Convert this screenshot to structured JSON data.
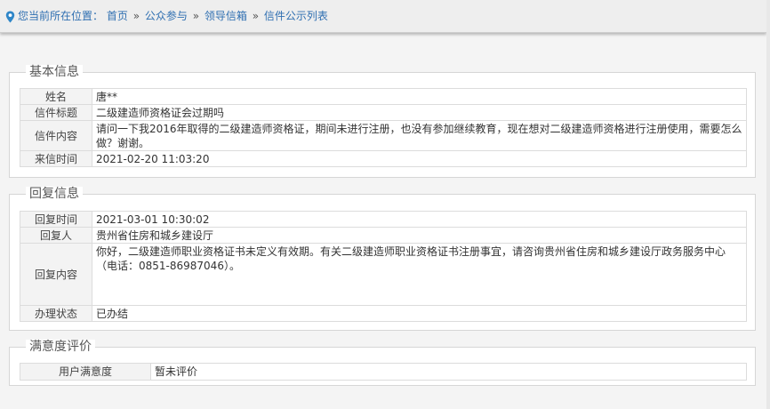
{
  "breadcrumb": {
    "prefix": "您当前所在位置：",
    "items": [
      "首页",
      "公众参与",
      "领导信箱",
      "信件公示列表"
    ],
    "separator": "»"
  },
  "basic_info": {
    "title": "基本信息",
    "rows": [
      {
        "label": "姓名",
        "value": "唐**"
      },
      {
        "label": "信件标题",
        "value": "二级建造师资格证会过期吗"
      },
      {
        "label": "信件内容",
        "value": "请问一下我2016年取得的二级建造师资格证，期间未进行注册，也没有参加继续教育，现在想对二级建造师资格进行注册使用，需要怎么做？谢谢。"
      },
      {
        "label": "来信时间",
        "value": "2021-02-20 11:03:20"
      }
    ]
  },
  "reply_info": {
    "title": "回复信息",
    "rows": [
      {
        "label": "回复时间",
        "value": "2021-03-01 10:30:02"
      },
      {
        "label": "回复人",
        "value": "贵州省住房和城乡建设厅"
      },
      {
        "label": "回复内容",
        "value": "你好，二级建造师职业资格证书未定义有效期。有关二级建造师职业资格证书注册事宜，请咨询贵州省住房和城乡建设厅政务服务中心（电话：0851-86987046）。"
      },
      {
        "label": "办理状态",
        "value": "已办结"
      }
    ]
  },
  "satisfaction": {
    "title": "满意度评价",
    "label": "用户满意度",
    "value": "暂未评价"
  },
  "colors": {
    "link": "#2f6fb1",
    "label_bg": "#f3f3f3",
    "border": "#dcdcdc"
  }
}
